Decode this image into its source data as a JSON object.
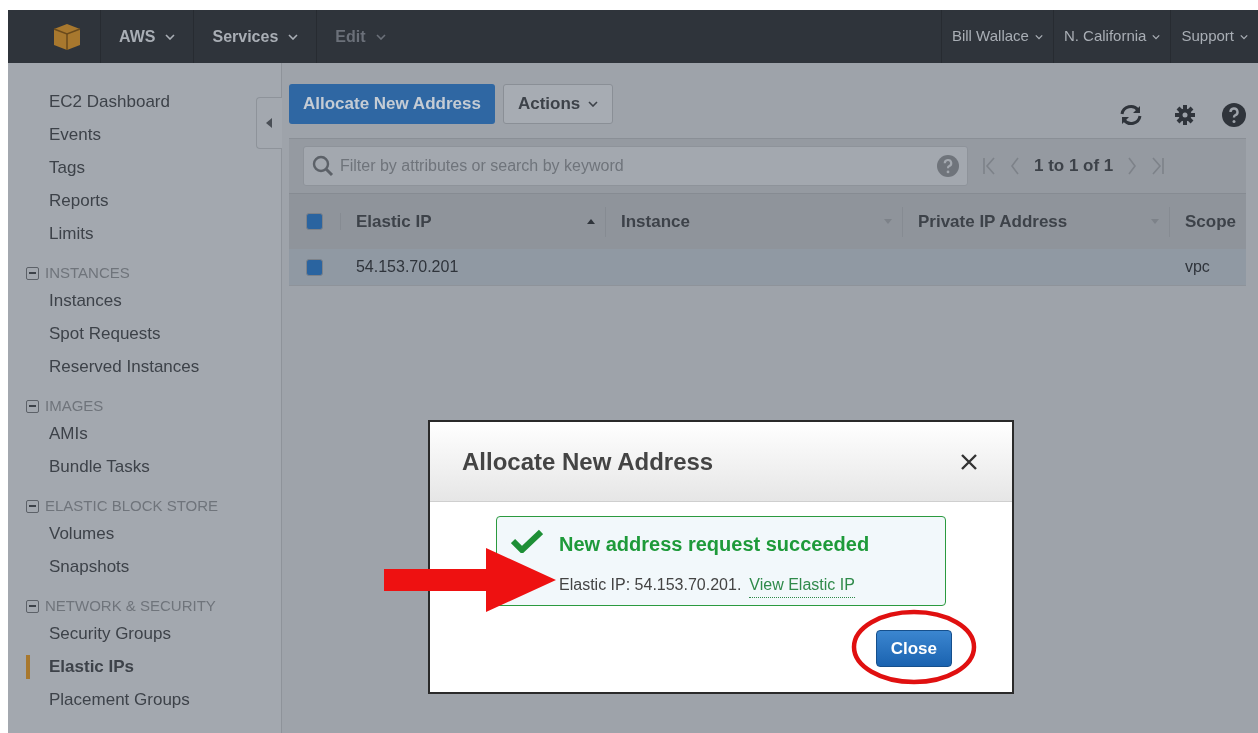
{
  "top_bar": {
    "menus": [
      {
        "label": "AWS",
        "disabled": false
      },
      {
        "label": "Services",
        "disabled": false
      },
      {
        "label": "Edit",
        "disabled": true
      }
    ],
    "right_menus": [
      "Bill Wallace",
      "N. California",
      "Support"
    ]
  },
  "sidebar": {
    "items": [
      {
        "label": "EC2 Dashboard",
        "selected": false
      },
      {
        "label": "Events",
        "selected": false
      },
      {
        "label": "Tags",
        "selected": false
      },
      {
        "label": "Reports",
        "selected": false
      },
      {
        "label": "Limits",
        "selected": false
      }
    ],
    "sections": [
      {
        "title": "INSTANCES",
        "expanded": true,
        "items": [
          {
            "label": "Instances",
            "selected": false
          },
          {
            "label": "Spot Requests",
            "selected": false
          },
          {
            "label": "Reserved Instances",
            "selected": false
          }
        ]
      },
      {
        "title": "IMAGES",
        "expanded": true,
        "items": [
          {
            "label": "AMIs",
            "selected": false
          },
          {
            "label": "Bundle Tasks",
            "selected": false
          }
        ]
      },
      {
        "title": "ELASTIC BLOCK STORE",
        "expanded": true,
        "items": [
          {
            "label": "Volumes",
            "selected": false
          },
          {
            "label": "Snapshots",
            "selected": false
          }
        ]
      },
      {
        "title": "NETWORK & SECURITY",
        "expanded": true,
        "items": [
          {
            "label": "Security Groups",
            "selected": false
          },
          {
            "label": "Elastic IPs",
            "selected": true
          },
          {
            "label": "Placement Groups",
            "selected": false
          }
        ]
      }
    ]
  },
  "toolbar": {
    "primary_button": "Allocate New Address",
    "actions_button": "Actions"
  },
  "filter": {
    "placeholder": "Filter by attributes or search by keyword",
    "pagination": "1 to 1 of 1"
  },
  "table": {
    "all_checked": true,
    "columns": [
      {
        "label": "Elastic IP",
        "kind": "sorted"
      },
      {
        "label": "Instance",
        "kind": "sortable"
      },
      {
        "label": "Private IP Address",
        "kind": "sortable"
      },
      {
        "label": "Scope",
        "kind": "plain"
      }
    ],
    "rows": [
      {
        "selected": true,
        "cells": [
          "54.153.70.201",
          "",
          "",
          "vpc"
        ]
      }
    ]
  },
  "dialog": {
    "title": "Allocate New Address",
    "message": {
      "heading": "New address request succeeded",
      "text": "Elastic IP: 54.153.70.201.",
      "link": "View Elastic IP"
    },
    "button": "Close"
  }
}
